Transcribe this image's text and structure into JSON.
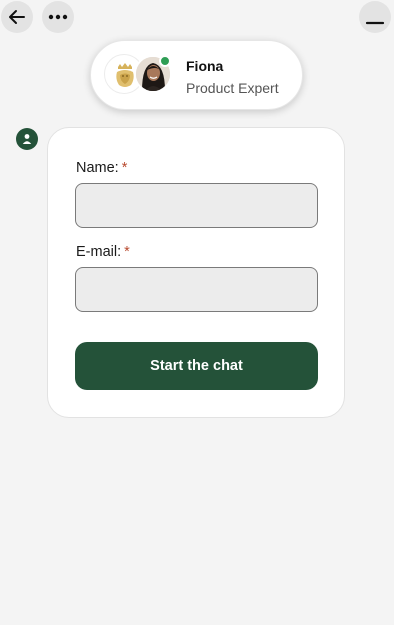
{
  "header": {
    "back_icon": "arrow-left-icon",
    "more_icon": "more-horizontal-icon",
    "minimize_icon": "minimize-icon"
  },
  "agent": {
    "name": "Fiona",
    "role": "Product Expert",
    "status": "online",
    "status_color": "#2f9e55"
  },
  "form": {
    "name_label": "Name:",
    "email_label": "E-mail:",
    "required_mark": "*",
    "name_value": "",
    "email_value": "",
    "submit_label": "Start the chat"
  },
  "colors": {
    "accent": "#245239",
    "required": "#b84a2f",
    "background": "#f4f4f4"
  }
}
